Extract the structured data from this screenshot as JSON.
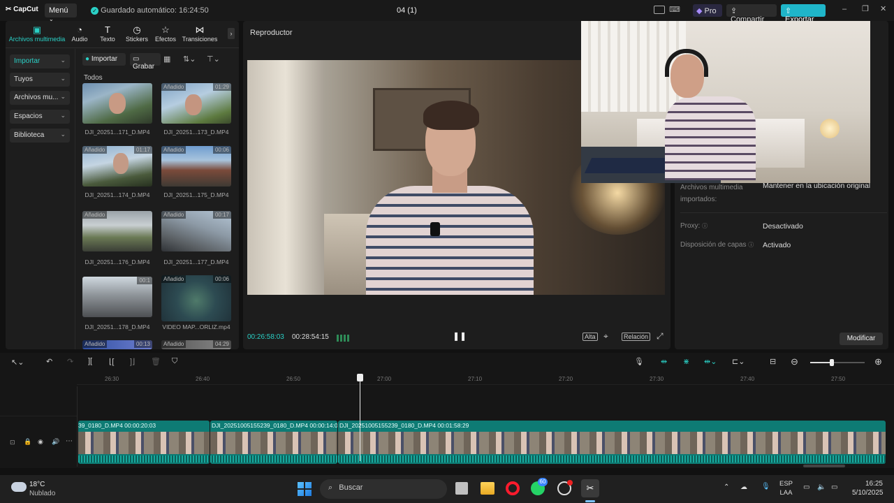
{
  "app": {
    "brand": "CapCut",
    "menu": "Menú",
    "autosave": "Guardado automático: 16:24:50",
    "project_title": "04 (1)",
    "pro": "Pro",
    "share": "Compartir",
    "export": "Exportar"
  },
  "media_tabs": [
    {
      "label": "Archivos multimedia",
      "icon": "media-icon"
    },
    {
      "label": "Audio",
      "icon": "audio-icon"
    },
    {
      "label": "Texto",
      "icon": "text-icon"
    },
    {
      "label": "Stickers",
      "icon": "stickers-icon"
    },
    {
      "label": "Efectos",
      "icon": "effects-icon"
    },
    {
      "label": "Transiciones",
      "icon": "transitions-icon"
    }
  ],
  "sidebar": [
    {
      "label": "Importar"
    },
    {
      "label": "Tuyos"
    },
    {
      "label": "Archivos mu..."
    },
    {
      "label": "Espacios"
    },
    {
      "label": "Biblioteca"
    }
  ],
  "media_toolbar": {
    "import": "Importar",
    "record": "Grabar"
  },
  "media_section": "Todos",
  "media_items": [
    {
      "name": "DJI_20251...171_D.MP4",
      "badge": "",
      "duration": ""
    },
    {
      "name": "DJI_20251...173_D.MP4",
      "badge": "Añadido",
      "duration": "01:29"
    },
    {
      "name": "DJI_20251...174_D.MP4",
      "badge": "Añadido",
      "duration": "01:17"
    },
    {
      "name": "DJI_20251...175_D.MP4",
      "badge": "Añadido",
      "duration": "00:06"
    },
    {
      "name": "DJI_20251...176_D.MP4",
      "badge": "Añadido",
      "duration": ""
    },
    {
      "name": "DJI_20251...177_D.MP4",
      "badge": "Añadido",
      "duration": "00:17"
    },
    {
      "name": "DJI_20251...178_D.MP4",
      "badge": "",
      "duration": "00:1"
    },
    {
      "name": "VIDEO MAP...ORLIZ.mp4",
      "badge": "Añadido",
      "duration": "00:06"
    },
    {
      "name": "",
      "badge": "Añadido",
      "duration": "00:13"
    },
    {
      "name": "",
      "badge": "Añadido",
      "duration": "04:29"
    }
  ],
  "player": {
    "title": "Reproductor",
    "current_time": "00:26:58:03",
    "total_time": "00:28:54:15",
    "quality": "Alta",
    "ratio": "Relación"
  },
  "properties": [
    {
      "label": "Archivos multimedia importados:",
      "value": "Mantener en la ubicación original"
    },
    {
      "label": "Proxy:",
      "value": "Desactivado"
    },
    {
      "label": "Disposición de capas",
      "value": "Activado"
    }
  ],
  "modify_button": "Modificar",
  "ruler_marks": [
    "26:30",
    "26:40",
    "26:50",
    "27:00",
    "27:10",
    "27:20",
    "27:30",
    "27:40",
    "27:50"
  ],
  "clips": [
    {
      "name": "39_0180_D.MP4",
      "duration": "00:00:20:03"
    },
    {
      "name": "DJI_20251005155239_0180_D.MP4",
      "duration": "00:00:14:0"
    },
    {
      "name": "DJI_20251005155239_0180_D.MP4",
      "duration": "00:01:58:29"
    }
  ],
  "weather": {
    "temp": "18°C",
    "condition": "Nublado"
  },
  "taskbar": {
    "search": "Buscar",
    "whatsapp_badge": "60",
    "lang": "ESP",
    "lang2": "LAA",
    "time": "16:25",
    "date": "5/10/2025"
  },
  "colors": {
    "accent": "#2ad0c6",
    "export": "#1fb5c9",
    "clip": "#0e7b74"
  }
}
